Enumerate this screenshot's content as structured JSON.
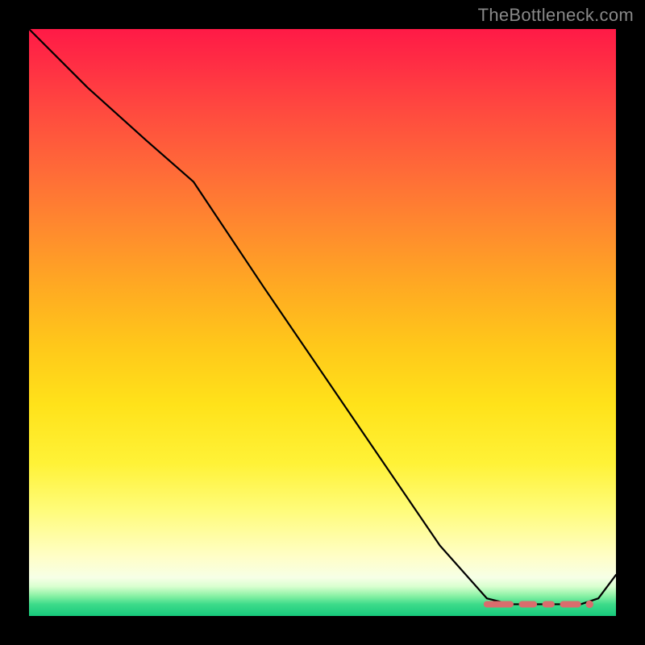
{
  "watermark": "TheBottleneck.com",
  "chart_data": {
    "type": "line",
    "title": "",
    "xlabel": "",
    "ylabel": "",
    "xlim": [
      0,
      100
    ],
    "ylim": [
      0,
      100
    ],
    "grid": false,
    "series": [
      {
        "name": "curve",
        "x": [
          0,
          10,
          20,
          28,
          40,
          55,
          70,
          78,
          82,
          86,
          90,
          94,
          97,
          100
        ],
        "y": [
          100,
          90,
          81,
          74,
          56,
          34,
          12,
          3,
          2,
          2,
          2,
          2,
          3,
          7
        ]
      }
    ],
    "markers": {
      "name": "dashed-range",
      "style": "dashed-red",
      "x_segments": [
        [
          78,
          82
        ],
        [
          84,
          86
        ],
        [
          88,
          89
        ],
        [
          91,
          93.5
        ]
      ],
      "dot_x": 95.5,
      "y": 2
    },
    "gradient_stops": [
      {
        "pos": 0.0,
        "color": "#ff1a46"
      },
      {
        "pos": 0.34,
        "color": "#ff8a2e"
      },
      {
        "pos": 0.64,
        "color": "#ffe21a"
      },
      {
        "pos": 0.9,
        "color": "#fffec8"
      },
      {
        "pos": 1.0,
        "color": "#17c97c"
      }
    ]
  }
}
